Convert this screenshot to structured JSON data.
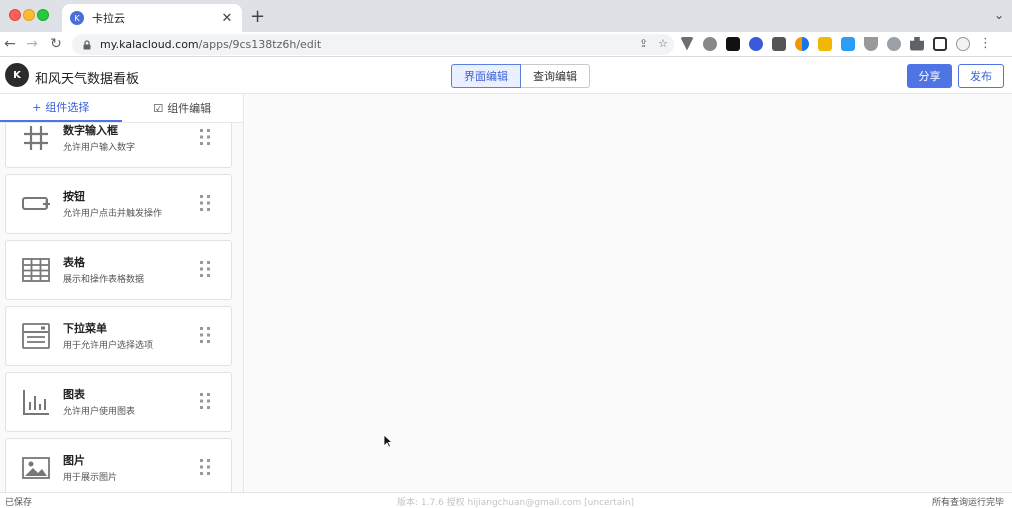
{
  "browser": {
    "tab_title": "卡拉云",
    "tab_favicon": "K",
    "url_host": "my.kalacloud.com",
    "url_path": "/apps/9cs138tz6h/edit"
  },
  "header": {
    "logo_text": "K",
    "app_title": "和风天气数据看板",
    "mode_ui": "界面编辑",
    "mode_query": "查询编辑",
    "share_label": "分享",
    "publish_label": "发布"
  },
  "sidebar": {
    "tab_select": "组件选择",
    "tab_select_icon": "+",
    "tab_edit": "组件编辑",
    "tab_edit_icon": "☑",
    "components": [
      {
        "name": "数字输入框",
        "desc": "允许用户输入数字",
        "icon": "hash-icon"
      },
      {
        "name": "按钮",
        "desc": "允许用户点击并触发操作",
        "icon": "button-icon"
      },
      {
        "name": "表格",
        "desc": "展示和操作表格数据",
        "icon": "table-icon"
      },
      {
        "name": "下拉菜单",
        "desc": "用于允许用户选择选项",
        "icon": "dropdown-icon"
      },
      {
        "name": "图表",
        "desc": "允许用户使用图表",
        "icon": "chart-icon"
      },
      {
        "name": "图片",
        "desc": "用于展示图片",
        "icon": "image-icon"
      }
    ]
  },
  "status": {
    "left": "已保存",
    "middle": "版本: 1.7.6 授权 hijiangchuan@gmail.com [uncertain]",
    "right": "所有查询运行完毕"
  },
  "colors": {
    "accent": "#4f74e3",
    "chrome_bg": "#dee1e6",
    "canvas_bg": "#fafafa"
  }
}
